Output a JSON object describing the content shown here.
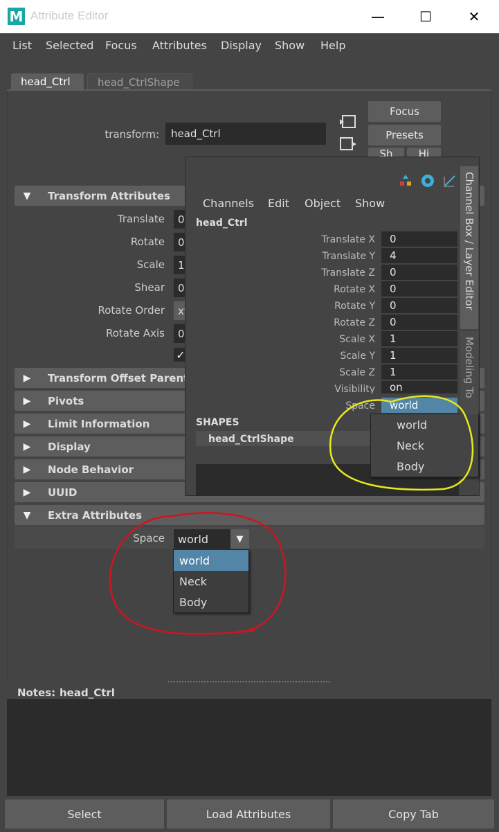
{
  "window": {
    "title": "Attribute Editor",
    "logo_letter": "M",
    "minimize_glyph": "—",
    "maximize_glyph": "☐",
    "close_glyph": "✕"
  },
  "menu": [
    "List",
    "Selected",
    "Focus",
    "Attributes",
    "Display",
    "Show",
    "Help"
  ],
  "tabs": [
    {
      "label": "head_Ctrl",
      "active": true
    },
    {
      "label": "head_CtrlShape",
      "active": false
    }
  ],
  "node": {
    "type_label": "transform:",
    "name": "head_Ctrl"
  },
  "side_buttons": {
    "focus": "Focus",
    "presets": "Presets",
    "show_partial": "Sh",
    "hide_partial": "Hi"
  },
  "sections": {
    "transform_attributes": "Transform Attributes",
    "transform_offset": "Transform Offset Parent M",
    "pivots": "Pivots",
    "limit_information": "Limit Information",
    "display": "Display",
    "node_behavior": "Node Behavior",
    "uuid": "UUID",
    "extra_attributes": "Extra Attributes"
  },
  "transform_rows": [
    {
      "label": "Translate",
      "value": "0"
    },
    {
      "label": "Rotate",
      "value": "0"
    },
    {
      "label": "Scale",
      "value": "1"
    },
    {
      "label": "Shear",
      "value": "0"
    },
    {
      "label": "Rotate Order",
      "value": "xy"
    },
    {
      "label": "Rotate Axis",
      "value": "0"
    }
  ],
  "inherits_checkbox": "✓",
  "extra": {
    "space_label": "Space",
    "space_value": "world",
    "options": [
      "world",
      "Neck",
      "Body"
    ],
    "selected_index": 0
  },
  "channel_box": {
    "menu": [
      "Channels",
      "Edit",
      "Object",
      "Show"
    ],
    "node_name": "head_Ctrl",
    "channels": [
      {
        "label": "Translate X",
        "value": "0"
      },
      {
        "label": "Translate Y",
        "value": "4"
      },
      {
        "label": "Translate Z",
        "value": "0"
      },
      {
        "label": "Rotate X",
        "value": "0"
      },
      {
        "label": "Rotate Y",
        "value": "0"
      },
      {
        "label": "Rotate Z",
        "value": "0"
      },
      {
        "label": "Scale X",
        "value": "1"
      },
      {
        "label": "Scale Y",
        "value": "1"
      },
      {
        "label": "Scale Z",
        "value": "1"
      },
      {
        "label": "Visibility",
        "value": "on"
      },
      {
        "label": "Space",
        "value": "world"
      }
    ],
    "shapes_header": "SHAPES",
    "shape_name": "head_CtrlShape",
    "dropdown_options": [
      "world",
      "Neck",
      "Body"
    ],
    "vertical_tab": "Channel Box / Layer Editor",
    "vertical_tab_2": "Modeling To"
  },
  "notes": {
    "label": "Notes:",
    "node": "head_Ctrl"
  },
  "bottom_buttons": [
    "Select",
    "Load Attributes",
    "Copy Tab"
  ],
  "colors": {
    "selected_highlight": "#5285a6",
    "red_annotation": "#d0141e",
    "yellow_annotation": "#e8e81c"
  }
}
